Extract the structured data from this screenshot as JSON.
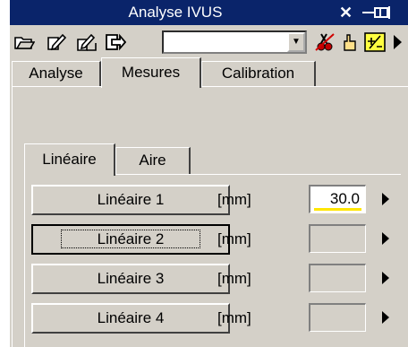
{
  "window": {
    "title": "Analyse IVUS",
    "close_glyph": "✕"
  },
  "toolbar": {
    "icons": [
      "open-folder-icon",
      "edit-note-icon",
      "edit-notes-icon",
      "export-icon",
      "red-scissors-icon",
      "hand-pointer-icon",
      "plus-minus-icon",
      "play-triangle-icon"
    ],
    "combo_value": ""
  },
  "tabs": {
    "outer": [
      "Analyse",
      "Mesures",
      "Calibration"
    ],
    "outer_selected": "Mesures",
    "inner": [
      "Linéaire",
      "Aire"
    ],
    "inner_selected": "Linéaire"
  },
  "measurements": [
    {
      "label": "Linéaire 1",
      "unit": "[mm]",
      "value": "30.0"
    },
    {
      "label": "Linéaire 2",
      "unit": "[mm]",
      "value": ""
    },
    {
      "label": "Linéaire 3",
      "unit": "[mm]",
      "value": ""
    },
    {
      "label": "Linéaire 4",
      "unit": "[mm]",
      "value": ""
    }
  ],
  "colors": {
    "title_bar": "#0a246a",
    "panel": "#d4d0c8",
    "value_underline": "#ffe600"
  }
}
